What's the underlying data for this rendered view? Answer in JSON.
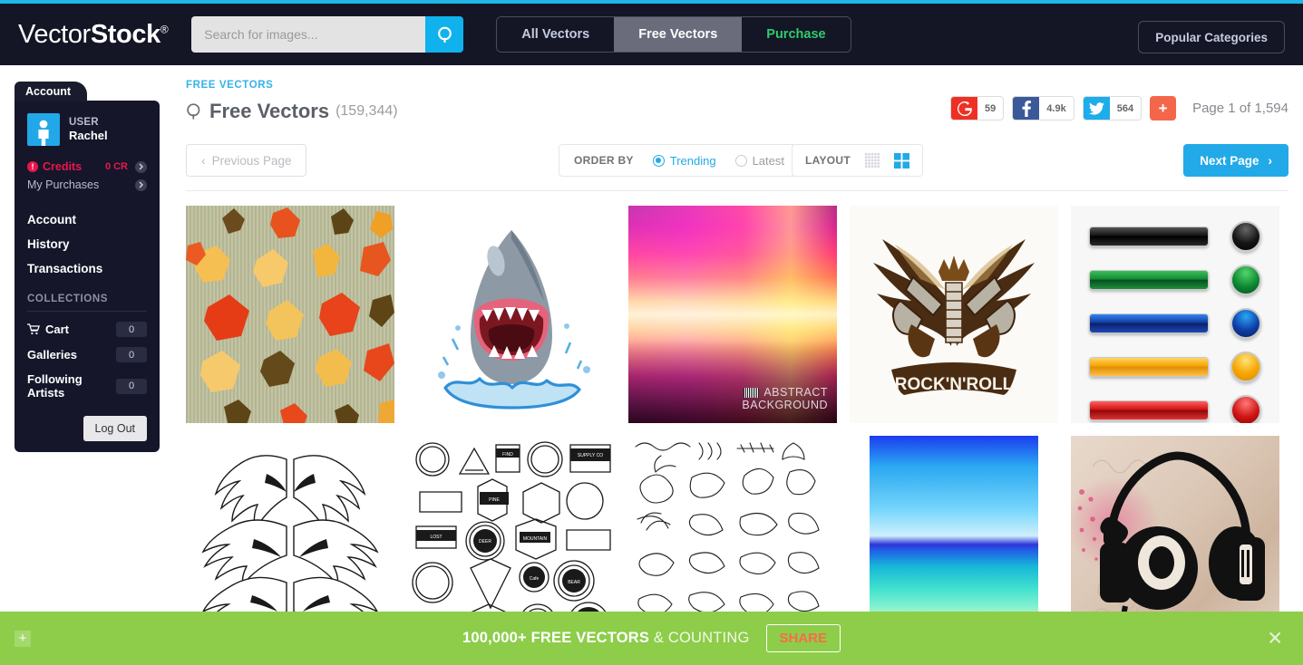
{
  "header": {
    "logo_light": "Vector",
    "logo_bold": "Stock",
    "logo_reg": "®",
    "search_placeholder": "Search for images...",
    "search_value": "",
    "search_icon": "search-icon",
    "nav_tabs": [
      {
        "label": "All Vectors",
        "active": false
      },
      {
        "label": "Free Vectors",
        "active": true
      },
      {
        "label": "Purchase",
        "active": false
      }
    ],
    "popular_categories": "Popular Categories"
  },
  "sidebar": {
    "tab_label": "Account",
    "user_role": "USER",
    "user_name": "Rachel",
    "credits_label": "Credits",
    "credits_value": "0 CR",
    "my_purchases": "My Purchases",
    "links": [
      "Account",
      "History",
      "Transactions"
    ],
    "collections_heading": "COLLECTIONS",
    "collections": [
      {
        "label": "Cart",
        "count": "0",
        "icon": "cart-icon"
      },
      {
        "label": "Galleries",
        "count": "0",
        "icon": ""
      },
      {
        "label": "Following Artists",
        "count": "0",
        "icon": ""
      }
    ],
    "logout": "Log Out"
  },
  "main": {
    "breadcrumb": "FREE VECTORS",
    "title": "Free Vectors",
    "count": "(159,344)",
    "page_indicator": "Page 1 of 1,594",
    "social": [
      {
        "name": "google",
        "count": "59",
        "glyph": "G"
      },
      {
        "name": "facebook",
        "count": "4.9k",
        "glyph": "f"
      },
      {
        "name": "twitter",
        "count": "564",
        "glyph": "t"
      },
      {
        "name": "share-more",
        "count": "",
        "glyph": "+"
      }
    ],
    "toolbar": {
      "previous_page": "Previous Page",
      "order_by_label": "ORDER BY",
      "order_options": [
        {
          "label": "Trending",
          "selected": true
        },
        {
          "label": "Latest",
          "selected": false
        }
      ],
      "layout_label": "LAYOUT",
      "layout_options": [
        {
          "name": "compact-grid",
          "selected": false
        },
        {
          "name": "large-grid",
          "selected": true
        }
      ],
      "next_page": "Next Page"
    },
    "results": [
      {
        "name": "autumn-leaves-seamless-pattern",
        "kind": "leaves",
        "label": ""
      },
      {
        "name": "shark-with-open-jaws-water-splash",
        "kind": "shark",
        "label": ""
      },
      {
        "name": "abstract-blurred-background",
        "kind": "abstract",
        "label_line1": "ABSTRACT",
        "label_line2": "BACKGROUND"
      },
      {
        "name": "rock-n-roll-winged-guns-emblem",
        "kind": "rock",
        "label": "ROCK'N'ROLL"
      },
      {
        "name": "glossy-web-buttons-set",
        "kind": "buttons",
        "colors": [
          "#1c1c1c",
          "#0f7a2e",
          "#1a2a9e",
          "#f5a300",
          "#d81414"
        ]
      },
      {
        "name": "angel-wings-illustration-set",
        "kind": "wings",
        "label": ""
      },
      {
        "name": "vintage-hipster-badges-labels",
        "kind": "badges",
        "label": ""
      },
      {
        "name": "hand-drawn-floral-ornaments",
        "kind": "floral",
        "label": ""
      },
      {
        "name": "tropical-beach-seascape",
        "kind": "beach",
        "label": ""
      },
      {
        "name": "grunge-headphones-poster",
        "kind": "headphones",
        "label": ""
      }
    ]
  },
  "banner": {
    "text_bold_1": "100,000+ FREE VECTORS",
    "text_light": "& COUNTING",
    "share_label": "SHARE",
    "close_icon": "close-icon",
    "plus_icon": "plus-icon"
  },
  "colors": {
    "accent": "#22aae8",
    "header_bg": "#141626",
    "banner_bg": "#8dcd4a",
    "credits_red": "#e8174b",
    "purchase_green": "#2ecc6a"
  }
}
